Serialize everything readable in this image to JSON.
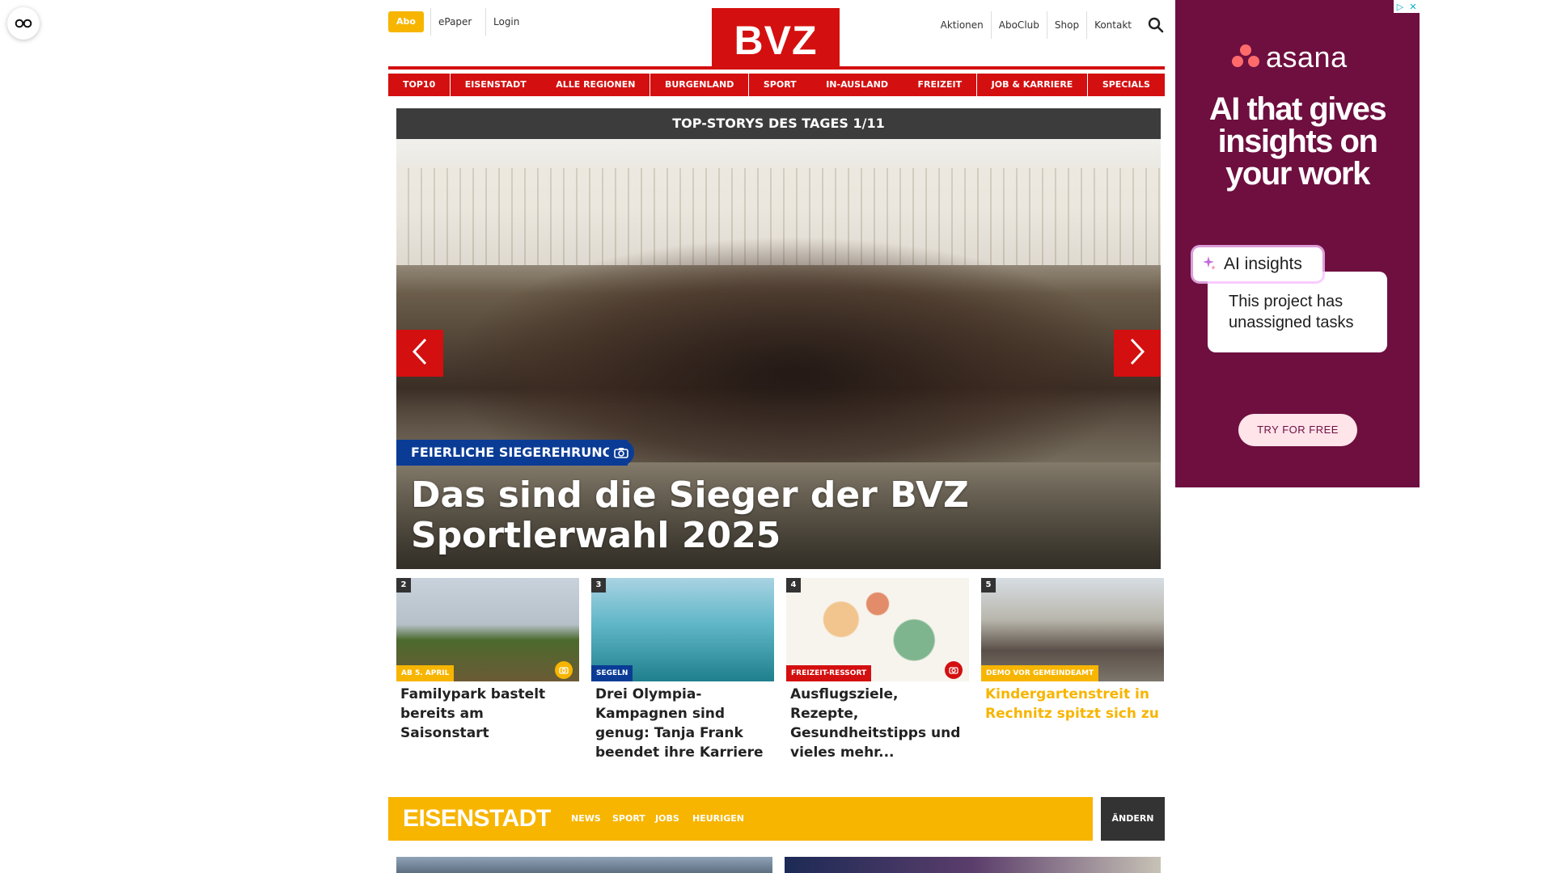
{
  "header": {
    "abo_label": "Abo",
    "epaper_label": "ePaper",
    "login_label": "Login",
    "logo_text": "BVZ",
    "right_links": [
      "Aktionen",
      "AboClub",
      "Shop",
      "Kontakt"
    ]
  },
  "nav": {
    "items": [
      "TOP10",
      "EISENSTADT",
      "ALLE REGIONEN",
      "BURGENLAND",
      "SPORT",
      "IN-AUSLAND",
      "FREIZEIT",
      "JOB & KARRIERE",
      "SPECIALS"
    ]
  },
  "top_stories": {
    "heading": "TOP-STORYS DES TAGES 1/11",
    "hero": {
      "category": "FEIERLICHE SIEGEREHRUNG",
      "title": "Das sind die Sieger der BVZ Sportlerwahl 2025"
    },
    "cards": [
      {
        "number": "2",
        "tag": "AB 5. APRIL",
        "tag_color": "#f7b500",
        "title": "Familypark bastelt bereits am Saisonstart",
        "title_color": "#222222",
        "icon": "camera-icon"
      },
      {
        "number": "3",
        "tag": "SEGELN",
        "tag_color": "#0a3c96",
        "title": "Drei Olympia-Kampagnen sind genug: Tanja Frank beendet ihre Karriere",
        "title_color": "#222222",
        "icon": ""
      },
      {
        "number": "4",
        "tag": "FREIZEIT-RESSORT",
        "tag_color": "#d40f0f",
        "title": "Ausflugsziele, Rezepte, Gesundheitstipps und vieles mehr...",
        "title_color": "#222222",
        "icon": "camera-icon"
      },
      {
        "number": "5",
        "tag": "DEMO VOR GEMEINDEAMT",
        "tag_color": "#f7b500",
        "title": "Kindergartenstreit in Rechnitz spitzt sich zu",
        "title_color": "#f7b500",
        "icon": ""
      }
    ]
  },
  "section": {
    "name": "EISENSTADT",
    "links": [
      "NEWS",
      "SPORT",
      "JOBS",
      "HEURIGEN"
    ],
    "change_label": "ÄNDERN"
  },
  "ad": {
    "brand": "asana",
    "headline": "AI that gives insights on your work",
    "pill_label": "AI insights",
    "card_text": "This project has unassigned tasks",
    "cta": "TRY FOR FREE"
  },
  "colors": {
    "brand_red": "#d40f0f",
    "accent_yellow": "#f7b500",
    "navy": "#0a3c96",
    "ad_background": "#6e0f3f"
  }
}
